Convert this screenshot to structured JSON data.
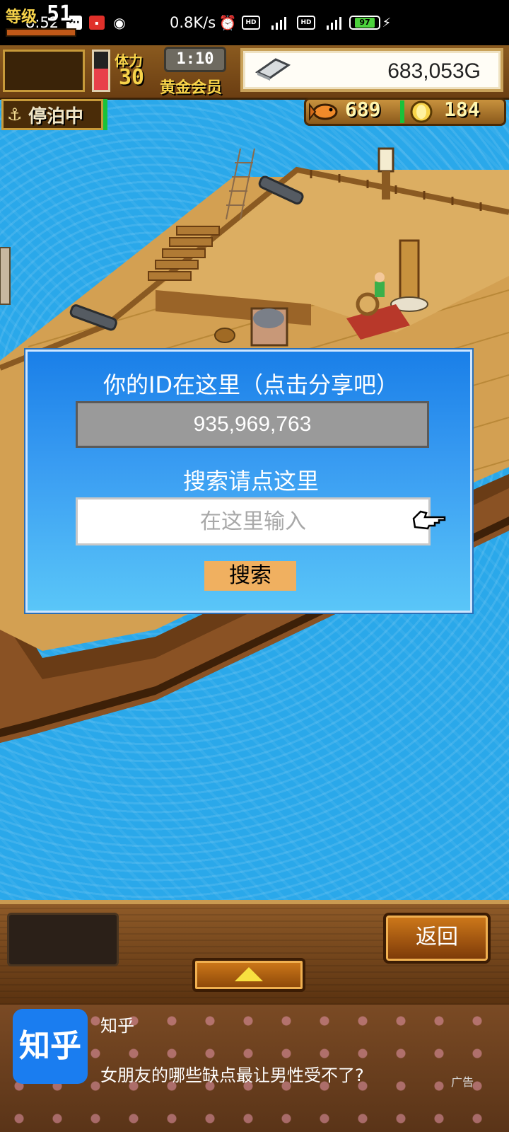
{
  "status_bar": {
    "time": "8:52",
    "net_speed": "0.8K/s",
    "battery": "97"
  },
  "hud": {
    "level_label": "等级",
    "level": "51",
    "stamina_label": "体力",
    "stamina": "30",
    "stamina_fill_fraction": 0.55,
    "timer": "1:10",
    "membership": "黄金会员",
    "gold": "683,053G",
    "dock_status": "停泊中",
    "fish_count": "689",
    "coin_count": "184"
  },
  "dialog": {
    "title": "你的ID在这里（点击分享吧）",
    "id_value": "935,969,763",
    "search_hint": "搜索请点这里",
    "input_placeholder": "在这里输入",
    "search_button": "搜索"
  },
  "bottom_menu": {
    "back_button": "返回"
  },
  "ad": {
    "logo_text": "知乎",
    "source": "知乎",
    "text": "女朋友的哪些缺点最让男性受不了?",
    "label": "广告"
  },
  "colors": {
    "ocean": "#2aa8ea",
    "dialog_top": "#1a7fe8",
    "dialog_bottom": "#5ac6f8",
    "search_button": "#f0b060",
    "zhihu_blue": "#1a7df0"
  }
}
